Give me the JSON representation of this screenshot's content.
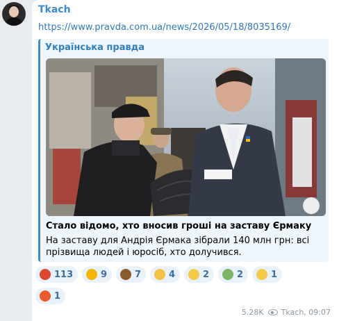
{
  "message": {
    "sender": "Tkach",
    "link": "https://www.pravda.com.ua/news/2026/05/18/8035169/",
    "views": "5.28K",
    "author_time": "Tkach, 09:07"
  },
  "preview": {
    "site": "Українська правда",
    "title": "Стало відомо, хто вносив гроші на заставу Єрмаку",
    "description": "На заставу для Андрія Єрмака зібрали 140 млн грн: всі прізвища людей і юросіб, хто долучився."
  },
  "reactions": [
    {
      "icon": "enraged-face-icon",
      "count": "113",
      "color": "#e0462b"
    },
    {
      "icon": "thumbs-up-icon",
      "count": "9",
      "color": "#f4b400"
    },
    {
      "icon": "pile-of-poo-icon",
      "count": "7",
      "color": "#8b5a2b"
    },
    {
      "icon": "clapping-hands-icon",
      "count": "4",
      "color": "#f4c142"
    },
    {
      "icon": "grinning-face-icon",
      "count": "2",
      "color": "#f7c948"
    },
    {
      "icon": "nauseated-face-icon",
      "count": "2",
      "color": "#7bb661"
    },
    {
      "icon": "thinking-face-icon",
      "count": "1",
      "color": "#f7c948"
    },
    {
      "icon": "angry-face-icon",
      "count": "1",
      "color": "#f05a28"
    }
  ]
}
